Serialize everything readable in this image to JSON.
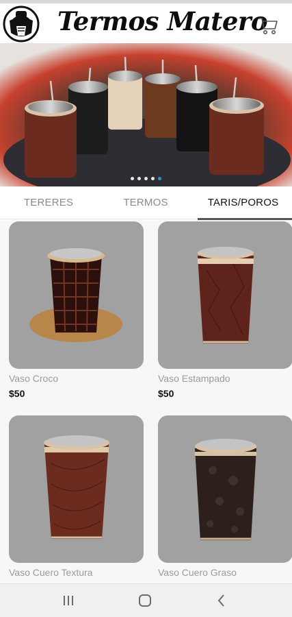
{
  "app": {
    "title": "Termos Matero"
  },
  "banner": {
    "slide_count": 5,
    "active_slide": 5
  },
  "tabs": [
    {
      "label": "TERERES",
      "selected": false
    },
    {
      "label": "TERMOS",
      "selected": false
    },
    {
      "label": "TARIS/POROS",
      "selected": true
    }
  ],
  "products": [
    {
      "name": "Vaso Croco",
      "price": "$50",
      "pattern": "croco"
    },
    {
      "name": "Vaso Estampado",
      "price": "$50",
      "pattern": "estampado"
    },
    {
      "name": "Vaso Cuero Textura",
      "price": "",
      "pattern": "textura"
    },
    {
      "name": "Vaso Cuero Graso",
      "price": "",
      "pattern": "graso"
    }
  ],
  "icons": {
    "logo": "mate-gourd-logo",
    "cart": "cart-icon",
    "nav_recent": "recent-apps-icon",
    "nav_home": "home-icon",
    "nav_back": "back-icon"
  },
  "colors": {
    "accent_dot": "#2a8fe0",
    "card_background": "#a1a1a1",
    "leather_brown": "#6b2c1f"
  }
}
